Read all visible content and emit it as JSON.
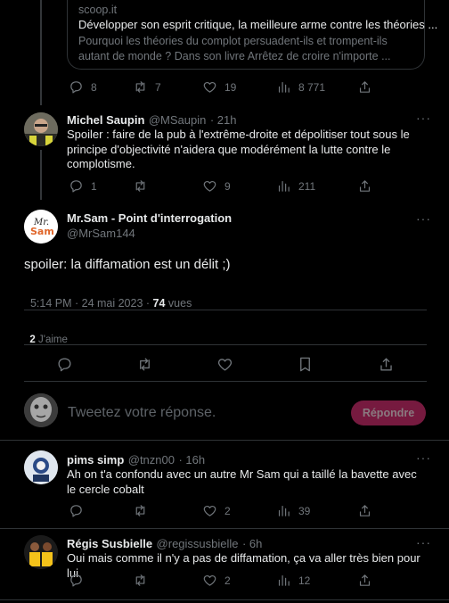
{
  "thread_top": {
    "card": {
      "domain": "scoop.it",
      "title": "Développer son esprit critique, la meilleure arme contre les théories ...",
      "description": "Pourquoi les théories du complot persuadent-ils et trompent-ils autant de monde ? Dans son livre Arrêtez de croire n'importe ..."
    },
    "actions": {
      "replies": "8",
      "retweets": "7",
      "likes": "19",
      "views": "8 771"
    }
  },
  "tweet_michel": {
    "name": "Michel Saupin",
    "handle": "@MSaupin",
    "time": "· 21h",
    "text": "Spoiler : faire de la pub à l'extrême-droite et dépolitiser tout sous le principe d'objectivité n'aidera que modérément la lutte contre le complotisme.",
    "actions": {
      "replies": "1",
      "retweets": "",
      "likes": "9",
      "views": "211"
    }
  },
  "main_tweet": {
    "name": "Mr.Sam - Point d'interrogation",
    "handle": "@MrSam144",
    "text": "spoiler: la diffamation est un délit ;)",
    "timestamp": "5:14 PM · 24 mai 2023 · ",
    "views_count": "74",
    "views_label": " vues",
    "likes_count": "2",
    "likes_label": " J'aime"
  },
  "reply_box": {
    "placeholder": "Tweetez votre réponse.",
    "button": "Répondre"
  },
  "tweet_pims": {
    "name": "pims simp",
    "handle": "@tnzn00",
    "time": "· 16h",
    "text": "Ah on t'a confondu avec un autre Mr Sam qui a taillé la bavette avec le cercle cobalt",
    "actions": {
      "replies": "",
      "retweets": "",
      "likes": "2",
      "views": "39"
    }
  },
  "tweet_regis": {
    "name": "Régis Susbielle",
    "handle": "@regissusbielle",
    "time": "· 6h",
    "text": "Oui mais comme il n'y a pas de diffamation, ça va aller très bien pour lui.",
    "actions": {
      "replies": "",
      "retweets": "",
      "likes": "2",
      "views": "12"
    }
  },
  "colors": {
    "background": "#000000",
    "accent": "#761a3f",
    "muted": "#71767b",
    "border": "#2f3336"
  }
}
